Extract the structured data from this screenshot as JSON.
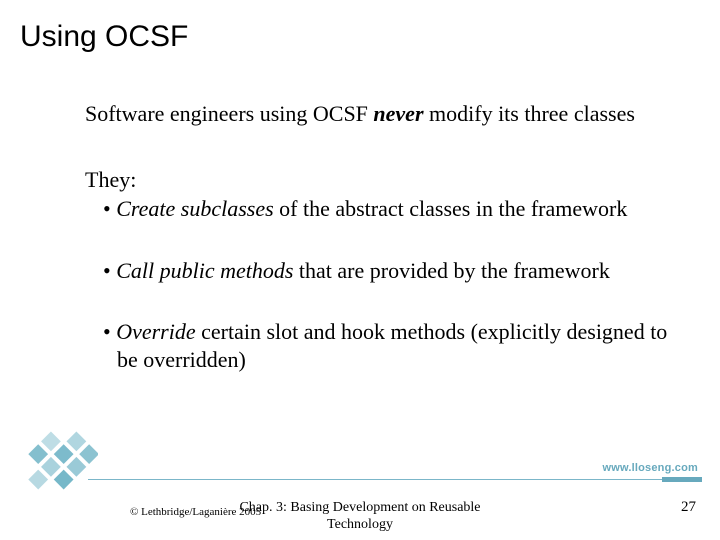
{
  "title": "Using OCSF",
  "body": {
    "lead_pre": "Software engineers using OCSF ",
    "lead_em": "never",
    "lead_post": " modify its three classes",
    "they": "They:",
    "bullets": [
      {
        "em": "Create subclasses",
        "rest": " of the abstract classes in the framework"
      },
      {
        "em": "Call public methods",
        "rest": " that are provided by the framework"
      },
      {
        "em": "Override",
        "rest": " certain slot and hook methods (explicitly designed to be overridden)"
      }
    ]
  },
  "site": "www.lloseng.com",
  "footer": {
    "copyright": "© Lethbridge/Laganière 2005",
    "chapter": "Chap. 3: Basing Development on Reusable Technology",
    "page": "27"
  },
  "deco_color": "#6fb4c6"
}
